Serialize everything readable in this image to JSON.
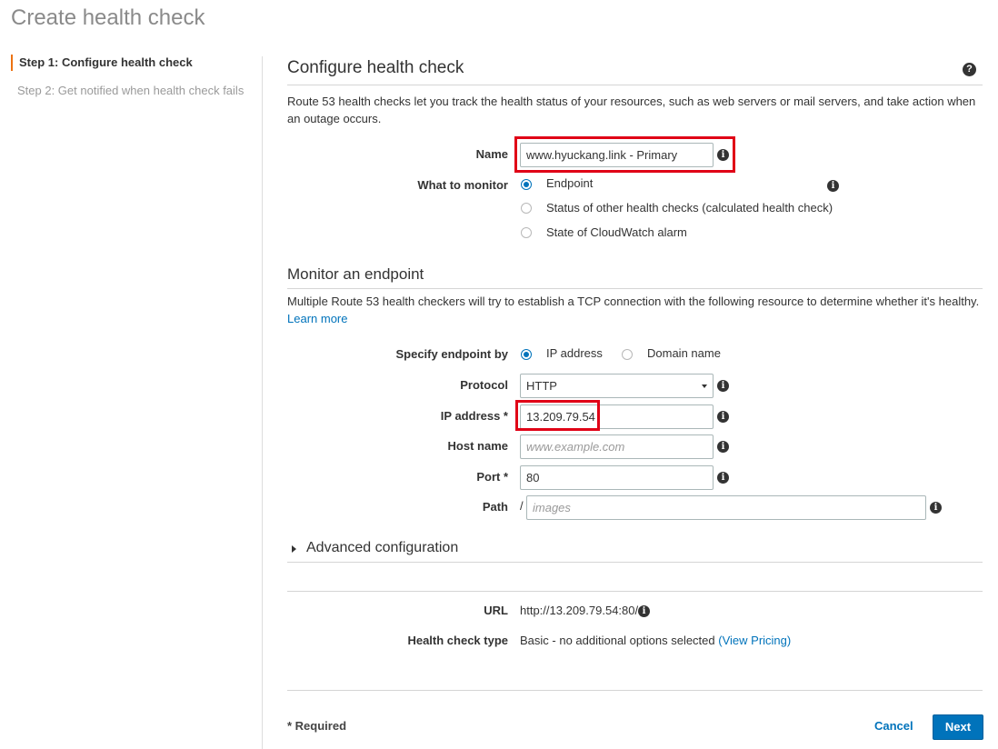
{
  "page": {
    "title": "Create health check"
  },
  "steps": [
    {
      "label": "Step 1: Configure health check"
    },
    {
      "label": "Step 2: Get notified when health check fails"
    }
  ],
  "configure": {
    "title": "Configure health check",
    "description": "Route 53 health checks let you track the health status of your resources, such as web servers or mail servers, and take action when an outage occurs.",
    "name_label": "Name",
    "name_value": "www.hyuckang.link - Primary",
    "monitor_label": "What to monitor",
    "monitor_options": [
      {
        "label": "Endpoint",
        "selected": true
      },
      {
        "label": "Status of other health checks (calculated health check)",
        "selected": false
      },
      {
        "label": "State of CloudWatch alarm",
        "selected": false
      }
    ]
  },
  "endpoint": {
    "title": "Monitor an endpoint",
    "description": "Multiple Route 53 health checkers will try to establish a TCP connection with the following resource to determine whether it's healthy.",
    "learn_more": "Learn more",
    "specify_label": "Specify endpoint by",
    "specify_options": [
      {
        "label": "IP address",
        "selected": true
      },
      {
        "label": "Domain name",
        "selected": false
      }
    ],
    "protocol_label": "Protocol",
    "protocol_value": "HTTP",
    "ip_label": "IP address *",
    "ip_value": "13.209.79.54",
    "host_label": "Host name",
    "host_placeholder": "www.example.com",
    "port_label": "Port *",
    "port_value": "80",
    "path_label": "Path",
    "path_prefix": "/",
    "path_placeholder": "images"
  },
  "advanced": {
    "label": "Advanced configuration"
  },
  "summary": {
    "url_label": "URL",
    "url_value": "http://13.209.79.54:80/",
    "type_label": "Health check type",
    "type_value": "Basic - no additional options selected",
    "view_pricing": "(View Pricing)"
  },
  "footer": {
    "required_note": "* Required",
    "cancel_label": "Cancel",
    "next_label": "Next"
  },
  "colors": {
    "accent": "#0073bb",
    "step_marker": "#ec7211",
    "highlight": "#e00016"
  }
}
